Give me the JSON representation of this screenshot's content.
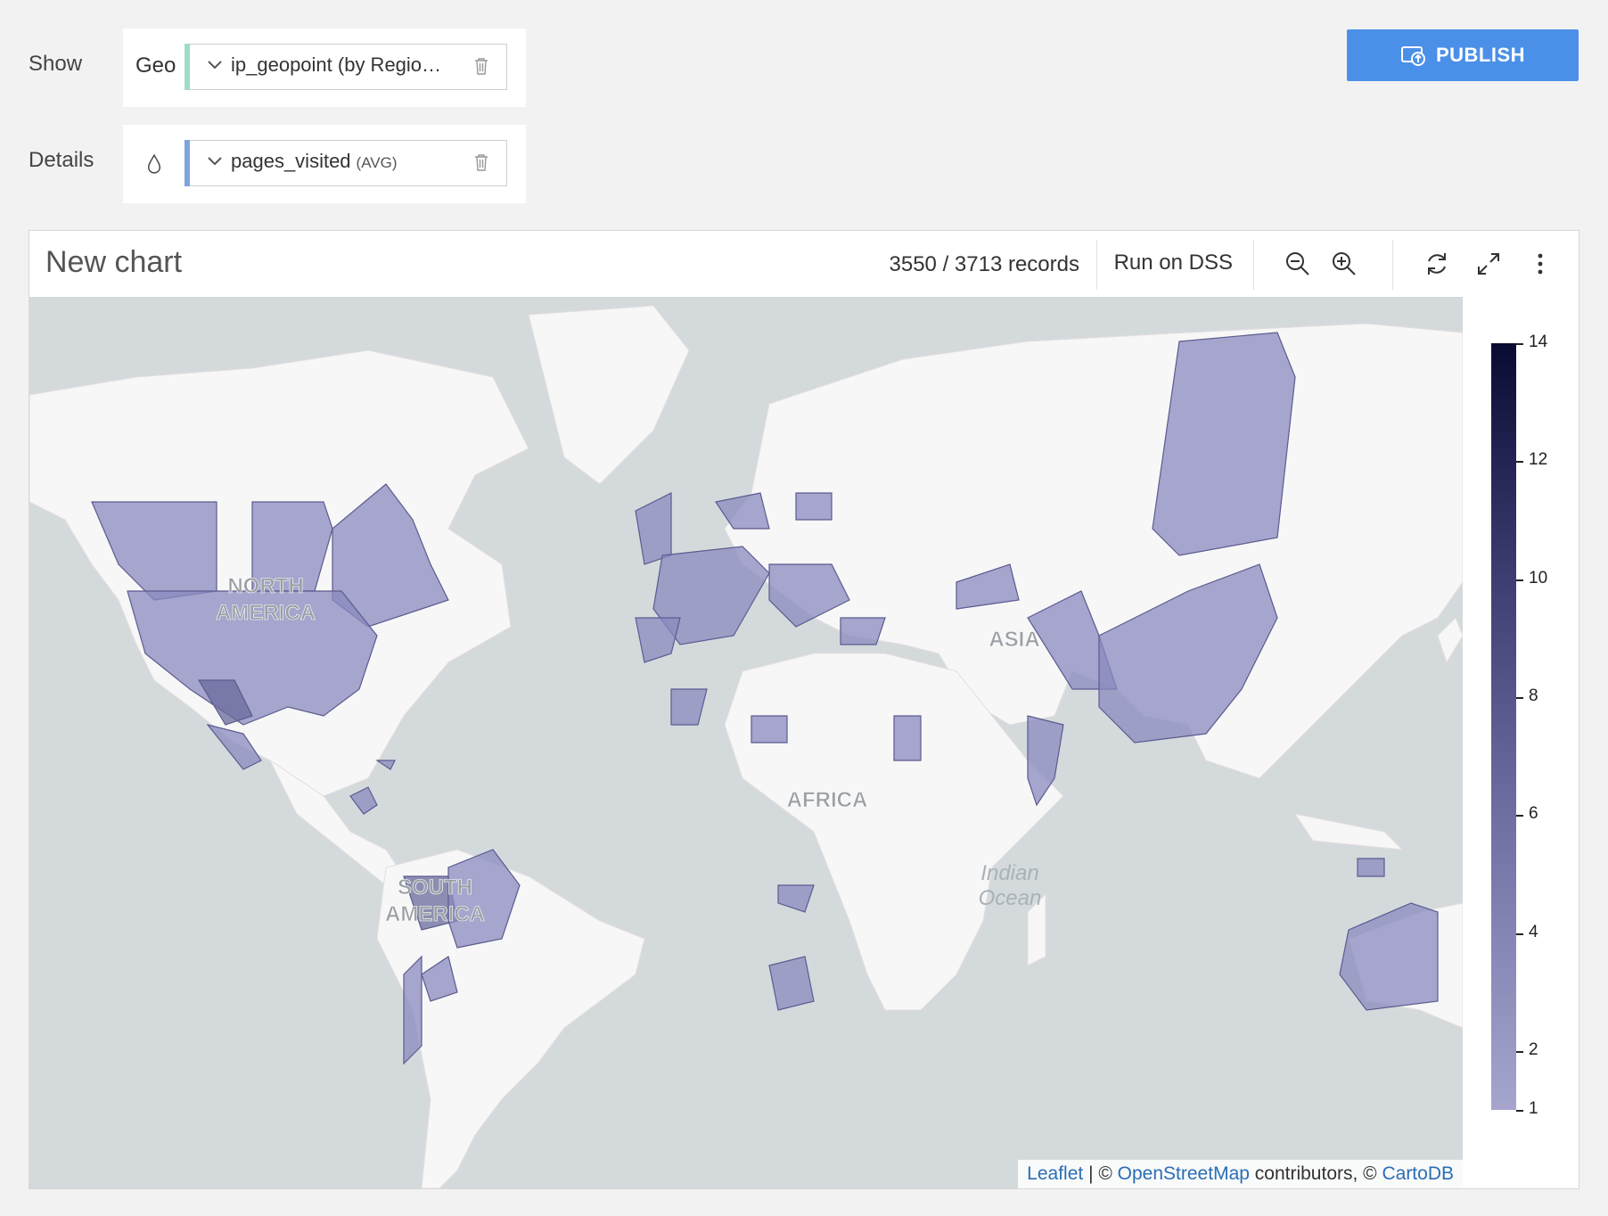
{
  "controls": {
    "show_label": "Show",
    "geo_prefix": "Geo",
    "geo_field": "ip_geopoint (by Regio…",
    "geo_bar_color": "#9fdcc4",
    "details_label": "Details",
    "details_field": "pages_visited",
    "details_agg": "(AVG)",
    "details_bar_color": "#7fa3e0"
  },
  "publish": {
    "label": "PUBLISH",
    "color": "#4a90e8"
  },
  "chart": {
    "title": "New chart",
    "records": "3550 / 3713 records",
    "run_label": "Run on DSS",
    "toolbar_icons": [
      "zoom-out-icon",
      "zoom-in-icon",
      "refresh-icon",
      "expand-icon",
      "more-vertical-icon"
    ]
  },
  "map": {
    "labels": [
      "NORTH AMERICA",
      "SOUTH AMERICA",
      "AFRICA",
      "ASIA",
      "Indian Ocean"
    ],
    "north_america_1": "NORTH",
    "north_america_2": "AMERICA",
    "south_america_1": "SOUTH",
    "south_america_2": "AMERICA",
    "africa": "AFRICA",
    "asia": "ASIA",
    "indian_1": "Indian",
    "indian_2": "Ocean",
    "attribution": {
      "leaflet": "Leaflet",
      "sep": " | © ",
      "osm": "OpenStreetMap",
      "middle": " contributors, © ",
      "carto": "CartoDB"
    },
    "colors": {
      "water": "#d4dadc",
      "land": "#f7f7f7",
      "region_fill": "#8a89bf"
    }
  },
  "legend": {
    "min": 1,
    "max": 14,
    "ticks": [
      "14",
      "12",
      "10",
      "8",
      "6",
      "4",
      "2",
      "1"
    ]
  }
}
